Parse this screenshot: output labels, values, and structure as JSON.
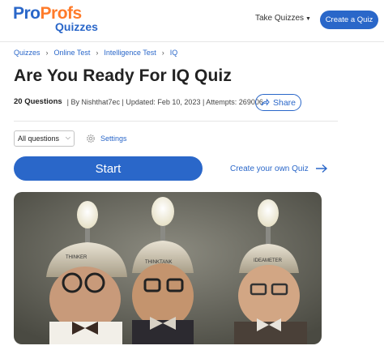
{
  "header": {
    "logo_pro": "Pro",
    "logo_profs": "Profs",
    "logo_sub": "Quizzes",
    "take_quizzes": "Take Quizzes",
    "create_quiz": "Create a Quiz"
  },
  "breadcrumb": [
    "Quizzes",
    "Online Test",
    "Intelligence Test",
    "IQ"
  ],
  "title": "Are You Ready For IQ Quiz",
  "meta": {
    "questions": "20 Questions",
    "details": "| By Nishthat7ec | Updated: Feb 10, 2023 | Attempts: 269006"
  },
  "share_label": "Share",
  "filter": {
    "selected": "All questions"
  },
  "settings_label": "Settings",
  "start_label": "Start",
  "create_own_label": "Create your own Quiz",
  "image": {
    "helmet_labels": [
      "THINKER",
      "THINKTANK",
      "IDEAMETER"
    ]
  },
  "colors": {
    "brand_blue": "#2a67c9",
    "brand_orange": "#ff7b2a"
  }
}
